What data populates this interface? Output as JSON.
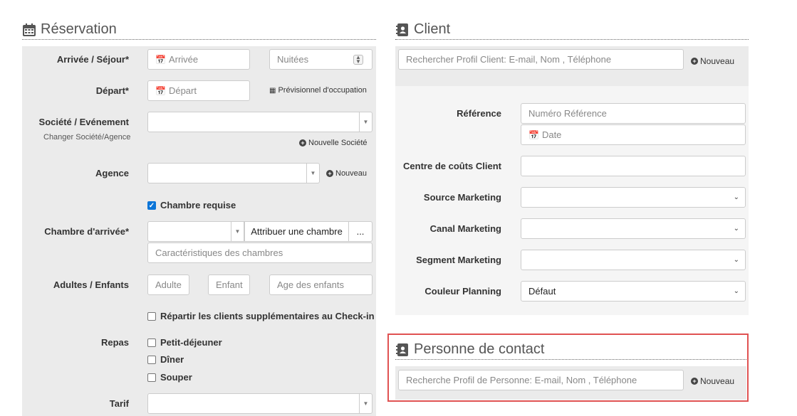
{
  "reservation": {
    "title": "Réservation",
    "arrival_label": "Arrivée / Séjour*",
    "arrival_placeholder": "Arrivée",
    "nights_placeholder": "Nuitées",
    "departure_label": "Départ*",
    "departure_placeholder": "Départ",
    "forecast_link": "Prévisionnel d'occupation",
    "company_label": "Société / Evénement",
    "change_company_link": "Changer Société/Agence",
    "new_company_link": "Nouvelle Société",
    "agency_label": "Agence",
    "agency_new_link": "Nouveau",
    "room_required_label": "Chambre requise",
    "arrival_room_label": "Chambre d'arrivée*",
    "assign_room_button": "Attribuer une chambre",
    "more_button": "...",
    "room_features_placeholder": "Caractéristiques des chambres",
    "adults_children_label": "Adultes / Enfants",
    "adult_placeholder": "Adulte",
    "child_placeholder": "Enfant",
    "children_age_placeholder": "Age des enfants",
    "split_clients_label": "Répartir les clients supplémentaires au Check-in",
    "meals_label": "Repas",
    "meals": [
      "Petit-déjeuner",
      "Dîner",
      "Souper"
    ],
    "rate_label": "Tarif"
  },
  "client": {
    "title": "Client",
    "search_placeholder": "Rechercher Profil Client: E-mail, Nom , Téléphone",
    "new_link": "Nouveau",
    "reference_label": "Référence",
    "reference_placeholder": "Numéro Référence",
    "date_placeholder": "Date",
    "cost_center_label": "Centre de coûts Client",
    "marketing_source_label": "Source Marketing",
    "marketing_channel_label": "Canal Marketing",
    "marketing_segment_label": "Segment Marketing",
    "planning_color_label": "Couleur Planning",
    "planning_color_value": "Défaut"
  },
  "contact": {
    "title": "Personne de contact",
    "search_placeholder": "Recherche Profil de Personne: E-mail, Nom , Téléphone",
    "new_link": "Nouveau"
  },
  "colors": {
    "panel_bg": "#ebebeb",
    "highlight_border": "#e05252",
    "checkbox_blue": "#0b75d8"
  }
}
